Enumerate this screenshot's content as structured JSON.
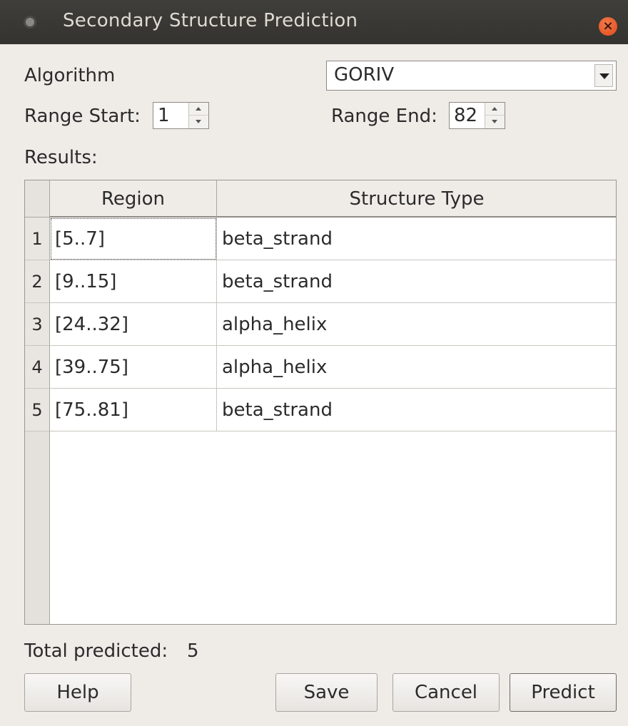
{
  "window": {
    "title": "Secondary Structure Prediction",
    "close_glyph": "×"
  },
  "algorithm": {
    "label": "Algorithm",
    "selected": "GORIV"
  },
  "range_start": {
    "label": "Range Start:",
    "value": "1"
  },
  "range_end": {
    "label": "Range End:",
    "value": "82"
  },
  "results": {
    "label": "Results:",
    "columns": [
      "Region",
      "Structure Type"
    ],
    "rows": [
      {
        "num": "1",
        "region": "[5..7]",
        "type": "beta_strand"
      },
      {
        "num": "2",
        "region": "[9..15]",
        "type": "beta_strand"
      },
      {
        "num": "3",
        "region": "[24..32]",
        "type": "alpha_helix"
      },
      {
        "num": "4",
        "region": "[39..75]",
        "type": "alpha_helix"
      },
      {
        "num": "5",
        "region": "[75..81]",
        "type": "beta_strand"
      }
    ]
  },
  "total": {
    "label": "Total predicted:",
    "value": "5"
  },
  "buttons": {
    "help": "Help",
    "save": "Save",
    "cancel": "Cancel",
    "predict": "Predict"
  }
}
